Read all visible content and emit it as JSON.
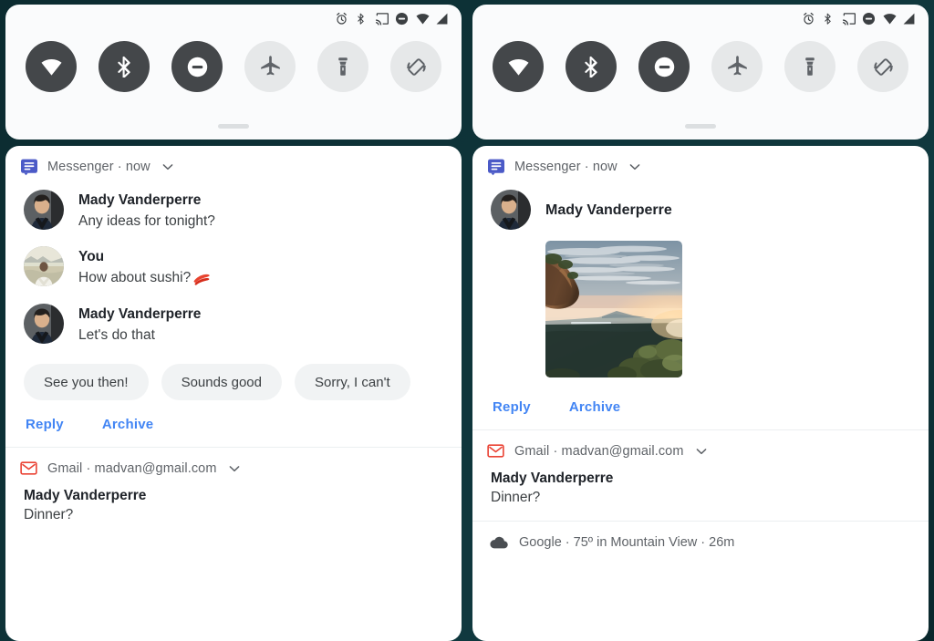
{
  "background_color": "#0d3034",
  "statusbar": {
    "icons": [
      "alarm-icon",
      "bluetooth-icon",
      "cast-icon",
      "do-not-disturb-icon",
      "wifi-icon",
      "signal-icon"
    ]
  },
  "quick_settings": {
    "tiles": [
      {
        "name": "wifi-tile",
        "icon": "wifi-icon",
        "state": "on"
      },
      {
        "name": "bluetooth-tile",
        "icon": "bluetooth-icon",
        "state": "on"
      },
      {
        "name": "dnd-tile",
        "icon": "do-not-disturb-icon",
        "state": "on"
      },
      {
        "name": "airplane-tile",
        "icon": "airplane-icon",
        "state": "off"
      },
      {
        "name": "flashlight-tile",
        "icon": "flashlight-icon",
        "state": "off"
      },
      {
        "name": "auto-rotate-tile",
        "icon": "auto-rotate-icon",
        "state": "off"
      }
    ],
    "handle": "drag-handle"
  },
  "colors": {
    "action_link": "#4285f4",
    "tile_on_bg": "#44474a",
    "tile_off_bg": "#e6e8e9",
    "chip_bg": "#f1f3f4",
    "messenger_blue": "#4b5ac7",
    "gmail_red": "#ea4335"
  },
  "left_panel": {
    "messenger": {
      "app_icon": "messages-icon",
      "header": "Messenger · now",
      "chevron": "chevron-down-icon",
      "messages": [
        {
          "sender": "Mady Vanderperre",
          "text": "Any ideas for tonight?",
          "avatar": "avatar-mady",
          "emoji": ""
        },
        {
          "sender": "You",
          "text": "How about sushi?",
          "avatar": "avatar-you",
          "emoji": "sushi-emoji"
        },
        {
          "sender": "Mady Vanderperre",
          "text": "Let's do that",
          "avatar": "avatar-mady",
          "emoji": ""
        }
      ],
      "smart_replies": [
        "See you then!",
        "Sounds good",
        "Sorry, I can't"
      ],
      "actions": [
        "Reply",
        "Archive"
      ]
    },
    "gmail": {
      "app_icon": "gmail-icon",
      "header": "Gmail · madvan@gmail.com",
      "chevron": "chevron-down-icon",
      "title": "Mady Vanderperre",
      "subtitle": "Dinner?"
    }
  },
  "right_panel": {
    "messenger": {
      "app_icon": "messages-icon",
      "header": "Messenger · now",
      "chevron": "chevron-down-icon",
      "sender": "Mady Vanderperre",
      "attachment": "landscape-photo-attachment",
      "actions": [
        "Reply",
        "Archive"
      ]
    },
    "gmail": {
      "app_icon": "gmail-icon",
      "header": "Gmail · madvan@gmail.com",
      "chevron": "chevron-down-icon",
      "title": "Mady Vanderperre",
      "subtitle": "Dinner?"
    },
    "google_weather": {
      "app_icon": "cloud-icon",
      "text": "Google · 75º in Mountain View · 26m"
    }
  }
}
